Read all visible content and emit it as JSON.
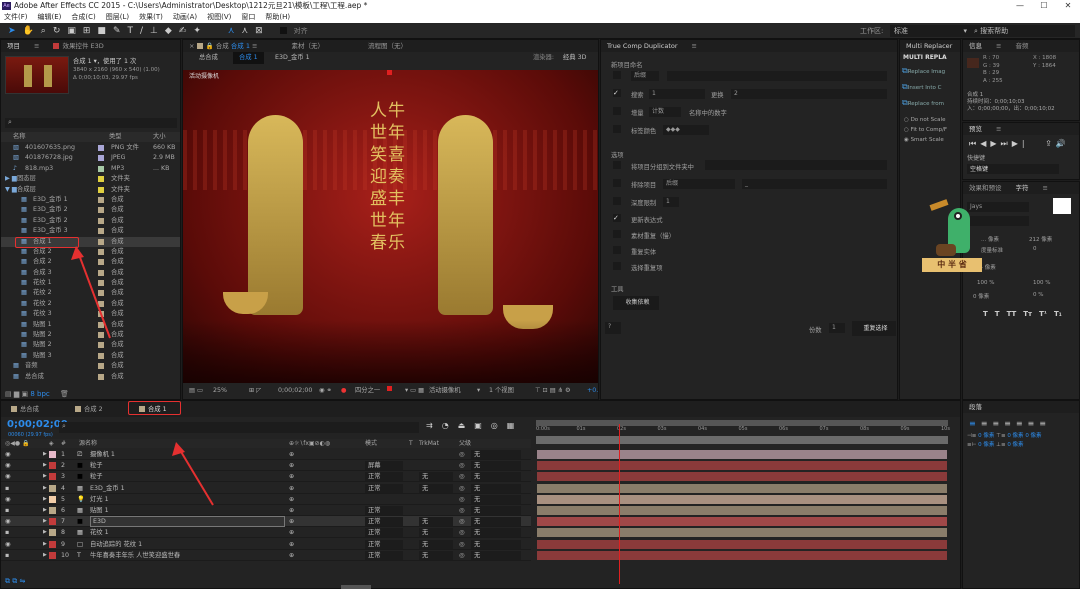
{
  "window": {
    "title": "Adobe After Effects CC 2015 - C:\\Users\\Administrator\\Desktop\\1212元旦21\\模板\\工程\\工程.aep *",
    "app_icon": "Ae"
  },
  "menu": [
    "文件(F)",
    "编辑(E)",
    "合成(C)",
    "图层(L)",
    "效果(T)",
    "动画(A)",
    "视图(V)",
    "窗口",
    "帮助(H)"
  ],
  "toolbar": {
    "snap_label": "对齐",
    "workspace_label": "工作区:",
    "workspace_value": "标准",
    "search_help": "搜索帮助"
  },
  "project": {
    "tabs": [
      "项目",
      "效果控件 E3D"
    ],
    "preview": {
      "name": "合成 1 ▾，使用了 1 次",
      "size": "3840 x 2160  (960 x 540) (1.00)",
      "duration": "Δ 0;00;10;03, 29.97 fps"
    },
    "columns": {
      "name": "名称",
      "type": "类型",
      "size": "大小"
    },
    "items": [
      {
        "name": "401607635.png",
        "type": "PNG 文件",
        "size": "660 KB",
        "color": "#a9a6d6",
        "kind": "file",
        "indent": 1
      },
      {
        "name": "401876728.jpg",
        "type": "JPEG",
        "size": "2.9 MB",
        "color": "#a9a6d6",
        "kind": "file",
        "indent": 1
      },
      {
        "name": "818.mp3",
        "type": "MP3",
        "size": "... KB",
        "color": "#a6c9a6",
        "kind": "audio",
        "indent": 1
      },
      {
        "name": "固态层",
        "type": "文件夹",
        "size": "",
        "color": "#e0d040",
        "kind": "folder",
        "indent": 0
      },
      {
        "name": "合成层",
        "type": "文件夹",
        "size": "",
        "color": "#e0d040",
        "kind": "folder-open",
        "indent": 0
      },
      {
        "name": "E3D_金币 1",
        "type": "合成",
        "size": "",
        "color": "#b8a888",
        "kind": "comp",
        "indent": 2
      },
      {
        "name": "E3D_金币 2",
        "type": "合成",
        "size": "",
        "color": "#b8a888",
        "kind": "comp",
        "indent": 2
      },
      {
        "name": "E3D_金币 2",
        "type": "合成",
        "size": "",
        "color": "#b8a888",
        "kind": "comp",
        "indent": 2
      },
      {
        "name": "E3D_金币 3",
        "type": "合成",
        "size": "",
        "color": "#b8a888",
        "kind": "comp",
        "indent": 2
      },
      {
        "name": "合成 1",
        "type": "合成",
        "size": "",
        "color": "#b8a888",
        "kind": "comp",
        "indent": 2,
        "selected": true
      },
      {
        "name": "合成 2",
        "type": "合成",
        "size": "",
        "color": "#b8a888",
        "kind": "comp",
        "indent": 2
      },
      {
        "name": "合成 2",
        "type": "合成",
        "size": "",
        "color": "#b8a888",
        "kind": "comp",
        "indent": 2
      },
      {
        "name": "合成 3",
        "type": "合成",
        "size": "",
        "color": "#b8a888",
        "kind": "comp",
        "indent": 2
      },
      {
        "name": "花纹 1",
        "type": "合成",
        "size": "",
        "color": "#b8a888",
        "kind": "comp",
        "indent": 2
      },
      {
        "name": "花纹 2",
        "type": "合成",
        "size": "",
        "color": "#b8a888",
        "kind": "comp",
        "indent": 2
      },
      {
        "name": "花纹 2",
        "type": "合成",
        "size": "",
        "color": "#b8a888",
        "kind": "comp",
        "indent": 2
      },
      {
        "name": "花纹 3",
        "type": "合成",
        "size": "",
        "color": "#b8a888",
        "kind": "comp",
        "indent": 2
      },
      {
        "name": "贴图 1",
        "type": "合成",
        "size": "",
        "color": "#b8a888",
        "kind": "comp",
        "indent": 2
      },
      {
        "name": "贴图 2",
        "type": "合成",
        "size": "",
        "color": "#b8a888",
        "kind": "comp",
        "indent": 2
      },
      {
        "name": "贴图 2",
        "type": "合成",
        "size": "",
        "color": "#b8a888",
        "kind": "comp",
        "indent": 2
      },
      {
        "name": "贴图 3",
        "type": "合成",
        "size": "",
        "color": "#b8a888",
        "kind": "comp",
        "indent": 2
      },
      {
        "name": "音频",
        "type": "合成",
        "size": "",
        "color": "#b8a888",
        "kind": "comp",
        "indent": 1
      },
      {
        "name": "总合成",
        "type": "合成",
        "size": "",
        "color": "#b8a888",
        "kind": "comp",
        "indent": 1
      }
    ],
    "bpc": "8 bpc"
  },
  "viewer": {
    "tabs": [
      "合成",
      "合成 1",
      "素材（无）",
      "流程图（无）"
    ],
    "breadcrumbs": [
      "总合成",
      "合成 1",
      "E3D_金币 1"
    ],
    "renderer_label": "渲染器:",
    "renderer_value": "经典 3D",
    "camera_label": "活动摄像机",
    "poster_text": [
      "人牛",
      "世年",
      "笑喜",
      "迎奏",
      "盛丰",
      "世年",
      "春乐"
    ],
    "footer": {
      "zoom": "25%",
      "timecode": "0;00;02;00",
      "resolution": "四分之一",
      "camera": "活动摄像机",
      "views": "1 个视图",
      "offset": "+0."
    }
  },
  "tcd": {
    "title": "True Comp Duplicator",
    "section_rename": "新项目命名",
    "prefix_select": "后缀",
    "find_label": "搜索",
    "find_value": "1",
    "replace_label": "更换",
    "replace_value": "2",
    "increment_label": "增量",
    "increment_select": "计数",
    "increment_suffix": "名称中的数字",
    "label_color_label": "标签颜色",
    "label_color_select": "◆◆◆",
    "section_options": "选项",
    "opt_group": "将项目分组到文件夹中",
    "opt_exclude": "排除项目",
    "exclude_select": "后缀",
    "exclude_value": "_",
    "opt_depth": "深度限制",
    "depth_value": "1",
    "opt_expr": "更新表达式",
    "opt_footage": "素材重复（慢）",
    "opt_solid": "重复实体",
    "opt_selected": "选择重复项",
    "checked": {
      "find": true,
      "expr": true
    },
    "section_tools": "工具",
    "collect_button": "收集依赖",
    "help_button": "?",
    "copies_label": "份数",
    "copies_value": "1",
    "duplicate_button": "重复选择"
  },
  "multi_replacer": {
    "title": "Multi Replacer",
    "header": "MULTI REPLA",
    "actions": [
      "Replace Imag",
      "Insert Into C",
      "Replace from"
    ],
    "scale_options": [
      "Do not Scale",
      "Fit to Comp/F",
      "Smart Scale"
    ],
    "selected_scale": "Smart Scale"
  },
  "info": {
    "tabs": [
      "信息",
      "音频"
    ],
    "r": "R : 70",
    "g": "G : 39",
    "b": "B : 29",
    "a": "A : 255",
    "x": "X : 1808",
    "y": "Y : 1864",
    "swatch": "#46271d",
    "comp": "合成 1",
    "duration": "持续时间：0;00;10;03",
    "inout": "入：0;00;00;00，出：0;00;10;02"
  },
  "preview_panel": {
    "title": "预览",
    "shortcut_label": "快捷键",
    "shortcut_value": "空格键"
  },
  "character": {
    "tabs": [
      "效果和预设",
      "字符"
    ],
    "font": "Jays",
    "leading": "212 像素",
    "kerning": "度量标准",
    "tracking": "0",
    "stroke": "- 像素",
    "vscale": "100 %",
    "hscale": "100 %",
    "baseline": "0 像素",
    "tsume": "0 %",
    "size": "... 像素",
    "styles": [
      "T",
      "T",
      "TT",
      "Tт",
      "T¹",
      "T₁"
    ]
  },
  "watermark": {
    "text": "中 半 省"
  },
  "paragraph": {
    "title": "段落",
    "indent_values": [
      "0 像素",
      "0 像素",
      "0 像素",
      "0 像素",
      "0 像素"
    ]
  },
  "timeline": {
    "tabs": [
      "总合成",
      "合成 2",
      "合成 1"
    ],
    "active_tab": "合成 1",
    "timecode": "0;00;02;00",
    "frame_info": "00060 (29.97 fps)",
    "columns": {
      "num": "#",
      "name": "源名称",
      "mode": "模式",
      "t": "T",
      "trkmat": "TrkMat",
      "parent": "父级"
    },
    "ruler": [
      "0:00s",
      "01s",
      "02s",
      "03s",
      "04s",
      "05s",
      "06s",
      "07s",
      "08s",
      "09s",
      "10s"
    ],
    "current_time_s": 2,
    "layers": [
      {
        "num": "1",
        "name": "摄像机 1",
        "color": "#e6b8c8",
        "kind": "camera",
        "mode": "",
        "trkmat": "",
        "parent": "无",
        "bar": "#9a838a"
      },
      {
        "num": "2",
        "name": "粒子",
        "color": "#c23b3b",
        "kind": "solid",
        "mode": "屏幕",
        "trkmat": "",
        "parent": "无",
        "bar": "#8a3a3a"
      },
      {
        "num": "3",
        "name": "粒子",
        "color": "#c23b3b",
        "kind": "solid",
        "mode": "正常",
        "trkmat": "无",
        "parent": "无",
        "bar": "#8a3a3a"
      },
      {
        "num": "4",
        "name": "E3D_金币 1",
        "color": "#b8a888",
        "kind": "comp",
        "mode": "正常",
        "trkmat": "无",
        "parent": "无",
        "bar": "#8a7d6a"
      },
      {
        "num": "5",
        "name": "灯光 1",
        "color": "#f2cda8",
        "kind": "light",
        "mode": "",
        "trkmat": "",
        "parent": "无",
        "bar": "#a89080"
      },
      {
        "num": "6",
        "name": "贴图 1",
        "color": "#b8a888",
        "kind": "comp",
        "mode": "正常",
        "trkmat": "",
        "parent": "无",
        "bar": "#8a7d6a"
      },
      {
        "num": "7",
        "name": "E3D",
        "color": "#c23b3b",
        "kind": "solid",
        "mode": "正常",
        "trkmat": "无",
        "parent": "无",
        "bar": "#a04848",
        "selected": true
      },
      {
        "num": "8",
        "name": "花纹 1",
        "color": "#b8a888",
        "kind": "comp",
        "mode": "正常",
        "trkmat": "无",
        "parent": "无",
        "bar": "#8a7d6a"
      },
      {
        "num": "9",
        "name": "自动追踪的 花纹 1",
        "color": "#c23b3b",
        "kind": "white-solid",
        "mode": "正常",
        "trkmat": "无",
        "parent": "无",
        "bar": "#8a3a3a"
      },
      {
        "num": "10",
        "name": "牛年喜奏丰年乐 人世笑迎盛世春",
        "color": "#c23b3b",
        "kind": "text",
        "mode": "正常",
        "trkmat": "无",
        "parent": "无",
        "bar": "#8a3a3a"
      }
    ]
  },
  "colors": {
    "accent": "#2d8ceb",
    "playhead": "#e02020",
    "annotation": "#e53030"
  }
}
